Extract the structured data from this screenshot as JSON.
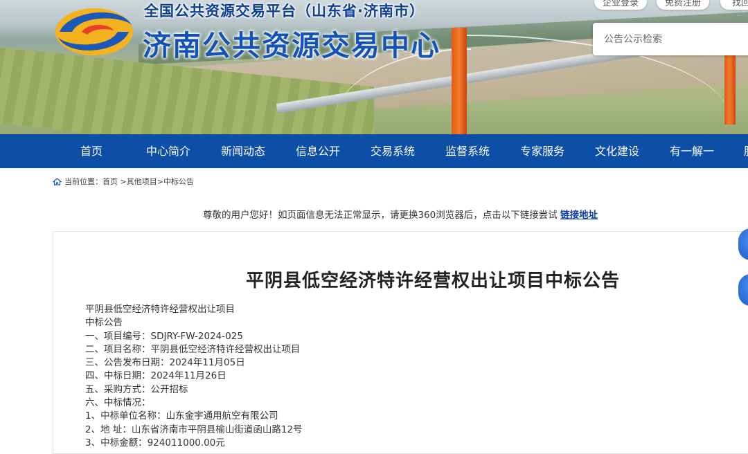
{
  "header": {
    "platform_title": "全国公共资源交易平台（山东省·济南市）",
    "center_title": "济南公共资源交易中心",
    "top_links": [
      "企业登录",
      "免费注册",
      "找回"
    ],
    "search_placeholder": "公告公示检索"
  },
  "nav": {
    "items": [
      "首页",
      "中心简介",
      "新闻动态",
      "信息公开",
      "交易系统",
      "监督系统",
      "专家服务",
      "文化建设",
      "有一解一",
      "服"
    ]
  },
  "breadcrumb": {
    "prefix": "当前位置：",
    "items": [
      "首页",
      "其他项目",
      "中标公告"
    ],
    "sep": " >"
  },
  "notice": {
    "text": "尊敬的用户您好！如页面信息无法正常显示，请更换360浏览器后，点击以下链接尝试 ",
    "link_label": "链接地址"
  },
  "article": {
    "title": "平阴县低空经济特许经营权出让项目中标公告",
    "lines": [
      "平阴县低空经济特许经营权出让项目",
      "中标公告",
      "一、项目编号：SDJRY-FW-2024-025",
      "二、项目名称：平阴县低空经济特许经营权出让项目",
      "三、公告发布日期：2024年11月05日",
      "四、中标日期：2024年11月26日",
      "五、采购方式：公开招标",
      "六、中标情况：",
      "1、中标单位名称：山东金宇通用航空有限公司",
      "2、地 址：山东省济南市平阴县榆山街道函山路12号",
      "3、中标金额：924011000.00元"
    ]
  },
  "colors": {
    "nav_bg": "#0d4ea6",
    "title_blue": "#1552b5",
    "link_blue": "#0d3fa6"
  }
}
